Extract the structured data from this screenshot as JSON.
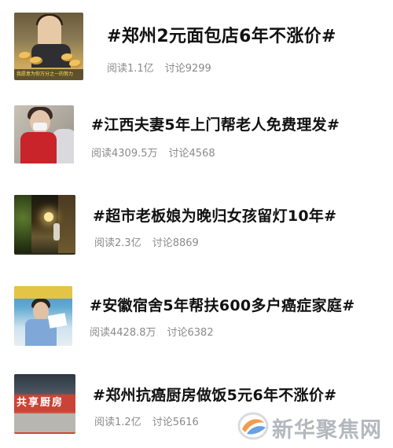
{
  "topics": [
    {
      "title": "#郑州2元面包店6年不涨价#",
      "read": "阅读1.1亿",
      "discuss": "讨论9299",
      "thumb_caption": "我愿意为你万分之一的努力"
    },
    {
      "title": "#江西夫妻5年上门帮老人免费理发#",
      "read": "阅读4309.5万",
      "discuss": "讨论4568"
    },
    {
      "title": "#超市老板娘为晚归女孩留灯10年#",
      "read": "阅读2.3亿",
      "discuss": "讨论8869"
    },
    {
      "title": "#安徽宿舍5年帮扶600多户癌症家庭#",
      "read": "阅读4428.8万",
      "discuss": "讨论6382"
    },
    {
      "title": "#郑州抗癌厨房做饭5元6年不涨价#",
      "read": "阅读1.2亿",
      "discuss": "讨论5616",
      "thumb_sign": "共享厨房"
    }
  ],
  "watermark": {
    "text": "新华聚焦网",
    "icon": "xinhua-logo-icon"
  },
  "colors": {
    "title": "#111111",
    "stats": "#8a8a8a",
    "watermark": "#b3b8bf"
  }
}
